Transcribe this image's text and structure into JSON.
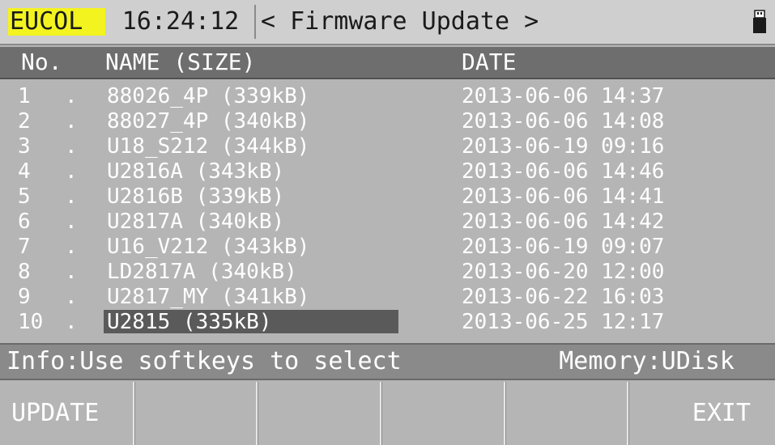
{
  "header": {
    "brand": "EUCOL",
    "time": "16:24:12",
    "title": "< Firmware Update >",
    "battery_icon": "usb-drive-icon"
  },
  "columns": {
    "no": "No.",
    "name": "NAME (SIZE)",
    "date": "DATE"
  },
  "files": [
    {
      "no": "1",
      "name": "88026_4P (339kB)",
      "date": "2013-06-06 14:37"
    },
    {
      "no": "2",
      "name": "88027_4P (340kB)",
      "date": "2013-06-06 14:08"
    },
    {
      "no": "3",
      "name": "U18_S212 (344kB)",
      "date": "2013-06-19 09:16"
    },
    {
      "no": "4",
      "name": "U2816A (343kB)",
      "date": "2013-06-06 14:46"
    },
    {
      "no": "5",
      "name": "U2816B (339kB)",
      "date": "2013-06-06 14:41"
    },
    {
      "no": "6",
      "name": "U2817A (340kB)",
      "date": "2013-06-06 14:42"
    },
    {
      "no": "7",
      "name": "U16_V212 (343kB)",
      "date": "2013-06-19 09:07"
    },
    {
      "no": "8",
      "name": "LD2817A (340kB)",
      "date": "2013-06-20 12:00"
    },
    {
      "no": "9",
      "name": "U2817_MY (341kB)",
      "date": "2013-06-22 16:03"
    },
    {
      "no": "10",
      "name": "U2815 (335kB)",
      "date": "2013-06-25 12:17"
    }
  ],
  "selected_index": 9,
  "info": {
    "message": "Info:Use softkeys to select",
    "memory": "Memory:UDisk"
  },
  "softkeys": [
    "UPDATE",
    "",
    "",
    "",
    "",
    "EXIT"
  ],
  "colors": {
    "brand_bg": "#f3f320",
    "header_bg": "#6e6e6e",
    "selection_bg": "#5a5a5a"
  }
}
